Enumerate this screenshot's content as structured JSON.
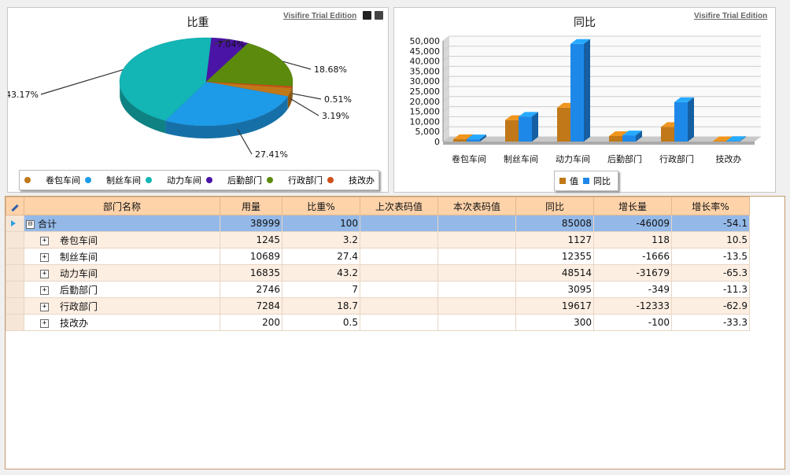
{
  "pie_panel": {
    "trial_text": "Visifire Trial Edition",
    "save_icon": "save-icon",
    "print_icon": "print-icon"
  },
  "bar_panel": {
    "trial_text": "Visifire Trial Edition"
  },
  "chart_data": [
    {
      "type": "pie",
      "title": "比重",
      "slices": [
        {
          "label": "卷包车间",
          "value": 3.19,
          "label_text": "3.19%",
          "color": "#c07818"
        },
        {
          "label": "制丝车间",
          "value": 27.41,
          "label_text": "27.41%",
          "color": "#1e9be8"
        },
        {
          "label": "动力车间",
          "value": 43.17,
          "label_text": "43.17%",
          "color": "#13b5b5"
        },
        {
          "label": "后勤部门",
          "value": 7.04,
          "label_text": "7.04%",
          "color": "#4a14a6"
        },
        {
          "label": "行政部门",
          "value": 18.68,
          "label_text": "18.68%",
          "color": "#5c8a0c"
        },
        {
          "label": "技改办",
          "value": 0.51,
          "label_text": "0.51%",
          "color": "#d0501a"
        }
      ],
      "legend": {
        "placement": "bottom",
        "entries": [
          "卷包车间",
          "制丝车间",
          "动力车间",
          "后勤部门",
          "行政部门",
          "技改办"
        ]
      }
    },
    {
      "type": "bar",
      "title": "同比",
      "categories": [
        "卷包车间",
        "制丝车间",
        "动力车间",
        "后勤部门",
        "行政部门",
        "技改办"
      ],
      "series": [
        {
          "name": "值",
          "values": [
            1245,
            10689,
            16835,
            2746,
            7284,
            200
          ],
          "color": "#c07818"
        },
        {
          "name": "同比",
          "values": [
            1127,
            12355,
            48514,
            3095,
            19617,
            300
          ],
          "color": "#1e88e8"
        }
      ],
      "ylim": [
        0,
        50000
      ],
      "yticks": [
        "0",
        "5,000",
        "10,000",
        "15,000",
        "20,000",
        "25,000",
        "30,000",
        "35,000",
        "40,000",
        "45,000",
        "50,000"
      ],
      "grid": true,
      "legend": {
        "placement": "bottom",
        "entries": [
          "值",
          "同比"
        ]
      }
    }
  ],
  "table": {
    "edit_icon": "pencil-icon",
    "columns": [
      "部门名称",
      "用量",
      "比重%",
      "上次表码值",
      "本次表码值",
      "同比",
      "增长量",
      "增长率%"
    ],
    "total_row": {
      "name": "合计",
      "expander": "⊟",
      "cells": [
        "38999",
        "100",
        "",
        "",
        "85008",
        "-46009",
        "-54.1"
      ]
    },
    "rows": [
      {
        "name": "卷包车间",
        "expander": "+",
        "cells": [
          "1245",
          "3.2",
          "",
          "",
          "1127",
          "118",
          "10.5"
        ]
      },
      {
        "name": "制丝车间",
        "expander": "+",
        "cells": [
          "10689",
          "27.4",
          "",
          "",
          "12355",
          "-1666",
          "-13.5"
        ]
      },
      {
        "name": "动力车间",
        "expander": "+",
        "cells": [
          "16835",
          "43.2",
          "",
          "",
          "48514",
          "-31679",
          "-65.3"
        ]
      },
      {
        "name": "后勤部门",
        "expander": "+",
        "cells": [
          "2746",
          "7",
          "",
          "",
          "3095",
          "-349",
          "-11.3"
        ]
      },
      {
        "name": "行政部门",
        "expander": "+",
        "cells": [
          "7284",
          "18.7",
          "",
          "",
          "19617",
          "-12333",
          "-62.9"
        ]
      },
      {
        "name": "技改办",
        "expander": "+",
        "cells": [
          "200",
          "0.5",
          "",
          "",
          "300",
          "-100",
          "-33.3"
        ]
      }
    ]
  }
}
